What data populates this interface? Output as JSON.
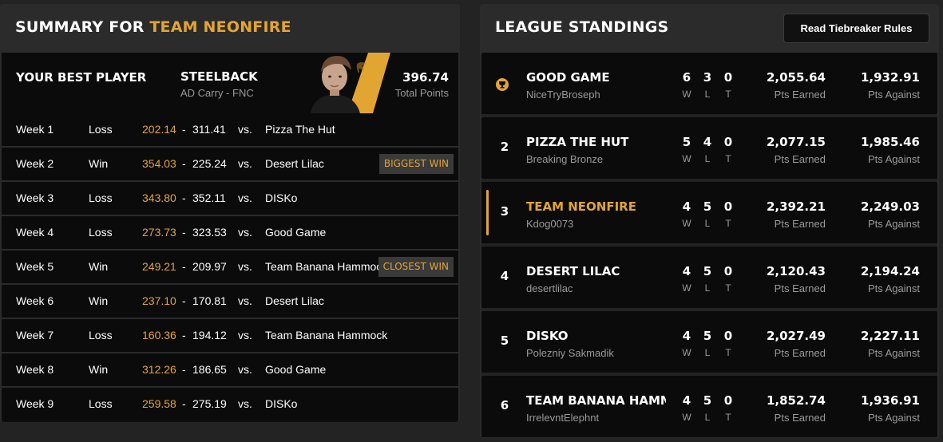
{
  "summary": {
    "title_prefix": "SUMMARY FOR",
    "team_name": "TEAM NEONFIRE",
    "best_player": {
      "label": "YOUR BEST PLAYER",
      "name": "STEELBACK",
      "role": "AD Carry - FNC",
      "points": "396.74",
      "points_label": "Total Points"
    },
    "weeks": [
      {
        "week": "Week 1",
        "result": "Loss",
        "score": "202.14",
        "sep": "-",
        "opp_score": "311.41",
        "vs": "vs.",
        "opponent": "Pizza The Hut",
        "tag": ""
      },
      {
        "week": "Week 2",
        "result": "Win",
        "score": "354.03",
        "sep": "-",
        "opp_score": "225.24",
        "vs": "vs.",
        "opponent": "Desert Lilac",
        "tag": "BIGGEST WIN"
      },
      {
        "week": "Week 3",
        "result": "Loss",
        "score": "343.80",
        "sep": "-",
        "opp_score": "352.11",
        "vs": "vs.",
        "opponent": "DISKo",
        "tag": ""
      },
      {
        "week": "Week 4",
        "result": "Loss",
        "score": "273.73",
        "sep": "-",
        "opp_score": "323.53",
        "vs": "vs.",
        "opponent": "Good Game",
        "tag": ""
      },
      {
        "week": "Week 5",
        "result": "Win",
        "score": "249.21",
        "sep": "-",
        "opp_score": "209.97",
        "vs": "vs.",
        "opponent": "Team Banana Hammock",
        "tag": "CLOSEST WIN"
      },
      {
        "week": "Week 6",
        "result": "Win",
        "score": "237.10",
        "sep": "-",
        "opp_score": "170.81",
        "vs": "vs.",
        "opponent": "Desert Lilac",
        "tag": ""
      },
      {
        "week": "Week 7",
        "result": "Loss",
        "score": "160.36",
        "sep": "-",
        "opp_score": "194.12",
        "vs": "vs.",
        "opponent": "Team Banana Hammock",
        "tag": ""
      },
      {
        "week": "Week 8",
        "result": "Win",
        "score": "312.26",
        "sep": "-",
        "opp_score": "186.65",
        "vs": "vs.",
        "opponent": "Good Game",
        "tag": ""
      },
      {
        "week": "Week 9",
        "result": "Loss",
        "score": "259.58",
        "sep": "-",
        "opp_score": "275.19",
        "vs": "vs.",
        "opponent": "DISKo",
        "tag": ""
      }
    ]
  },
  "standings": {
    "title": "LEAGUE STANDINGS",
    "rules_button": "Read Tiebreaker Rules",
    "labels": {
      "w": "W",
      "l": "L",
      "t": "T",
      "pts_earned": "Pts Earned",
      "pts_against": "Pts Against"
    },
    "teams": [
      {
        "rank": "1",
        "trophy": true,
        "name": "GOOD GAME",
        "owner": "NiceTryBroseph",
        "w": "6",
        "l": "3",
        "t": "0",
        "earned": "2,055.64",
        "against": "1,932.91",
        "current": false
      },
      {
        "rank": "2",
        "trophy": false,
        "name": "PIZZA THE HUT",
        "owner": "Breaking Bronze",
        "w": "5",
        "l": "4",
        "t": "0",
        "earned": "2,077.15",
        "against": "1,985.46",
        "current": false
      },
      {
        "rank": "3",
        "trophy": false,
        "name": "TEAM NEONFIRE",
        "owner": "Kdog0073",
        "w": "4",
        "l": "5",
        "t": "0",
        "earned": "2,392.21",
        "against": "2,249.03",
        "current": true
      },
      {
        "rank": "4",
        "trophy": false,
        "name": "DESERT LILAC",
        "owner": "desertlilac",
        "w": "4",
        "l": "5",
        "t": "0",
        "earned": "2,120.43",
        "against": "2,194.24",
        "current": false
      },
      {
        "rank": "5",
        "trophy": false,
        "name": "DISKO",
        "owner": "Polezniy Sakmadik",
        "w": "4",
        "l": "5",
        "t": "0",
        "earned": "2,027.49",
        "against": "2,227.11",
        "current": false
      },
      {
        "rank": "6",
        "trophy": false,
        "name": "TEAM BANANA HAMM…",
        "owner": "IrrelevntElephnt",
        "w": "4",
        "l": "5",
        "t": "0",
        "earned": "1,852.74",
        "against": "1,936.91",
        "current": false
      }
    ]
  },
  "colors": {
    "accent": "#e3a532",
    "row_bg": "#0b0b0b",
    "panel_bg": "#2b2b2b"
  },
  "icons": {
    "trophy": "trophy-icon",
    "player_photo": "player-photo",
    "team_logo": "team-logo"
  }
}
